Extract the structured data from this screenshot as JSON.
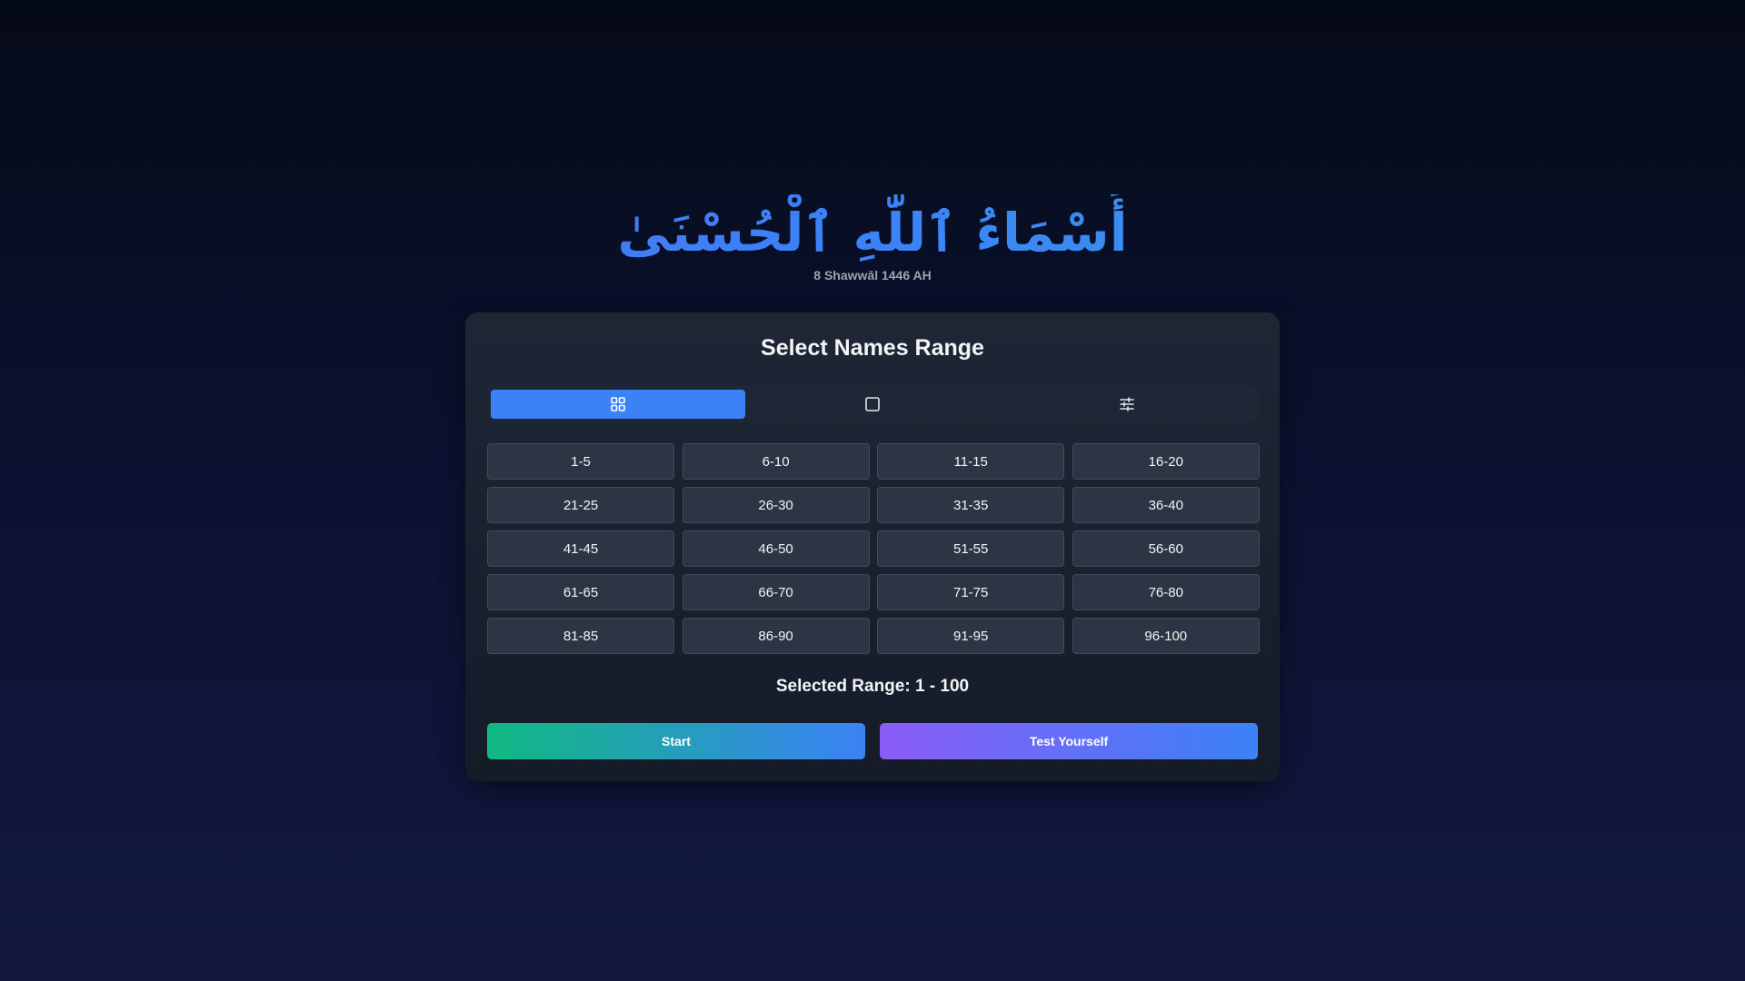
{
  "header": {
    "title": "أَسْمَاءُ ٱللَّٰهِ ٱلْحُسْنَىٰ",
    "date": "8 Shawwāl 1446 AH"
  },
  "card": {
    "title": "Select Names Range",
    "modes": [
      {
        "icon": "grid-icon",
        "active": true
      },
      {
        "icon": "square-icon",
        "active": false
      },
      {
        "icon": "sliders-icon",
        "active": false
      }
    ],
    "ranges": [
      "1-5",
      "6-10",
      "11-15",
      "16-20",
      "21-25",
      "26-30",
      "31-35",
      "36-40",
      "41-45",
      "46-50",
      "51-55",
      "56-60",
      "61-65",
      "66-70",
      "71-75",
      "76-80",
      "81-85",
      "86-90",
      "91-95",
      "96-100"
    ],
    "selected_range": "Selected Range: 1 - 100",
    "start_label": "Start",
    "test_label": "Test Yourself"
  },
  "colors": {
    "accent": "#3b82f6",
    "start_gradient": [
      "#10b981",
      "#3b82f6"
    ],
    "test_gradient": [
      "#8b5cf6",
      "#3b82f6"
    ]
  }
}
